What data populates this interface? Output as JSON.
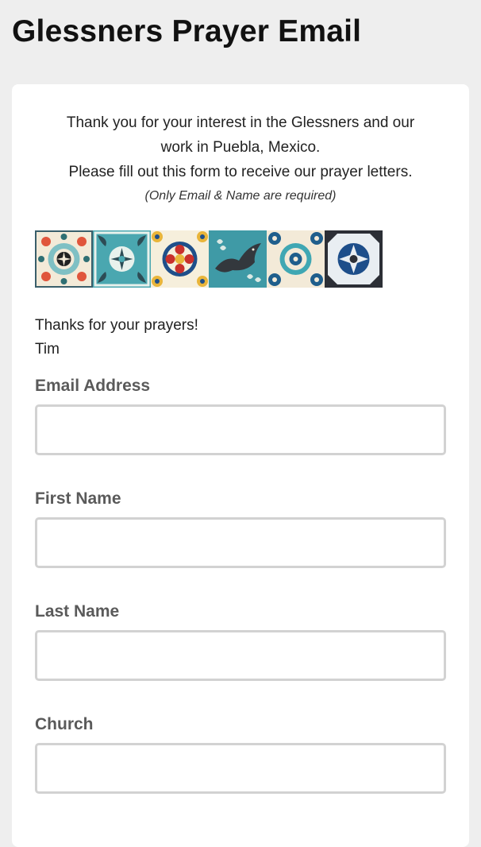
{
  "page": {
    "title": "Glessners Prayer Email"
  },
  "intro": {
    "line1": "Thank you for your interest in the Glessners and our",
    "line2": "work in Puebla, Mexico.",
    "line3": "Please fill out this form to receive our prayer letters.",
    "note": "(Only Email & Name are required)"
  },
  "banner": {
    "tiles": [
      "red-rosette-tile",
      "teal-cross-tile",
      "floral-medallion-tile",
      "teal-bird-tile",
      "blue-flower-tile",
      "navy-star-tile"
    ]
  },
  "signoff": {
    "line1": "Thanks for your prayers!",
    "line2": "Tim"
  },
  "form": {
    "fields": [
      {
        "label": "Email Address",
        "value": "",
        "placeholder": ""
      },
      {
        "label": "First Name",
        "value": "",
        "placeholder": ""
      },
      {
        "label": "Last Name",
        "value": "",
        "placeholder": ""
      },
      {
        "label": "Church",
        "value": "",
        "placeholder": ""
      }
    ]
  },
  "colors": {
    "background": "#eeeeee",
    "card": "#ffffff",
    "label": "#5a5a5a",
    "input_border": "#d2d2d2"
  }
}
